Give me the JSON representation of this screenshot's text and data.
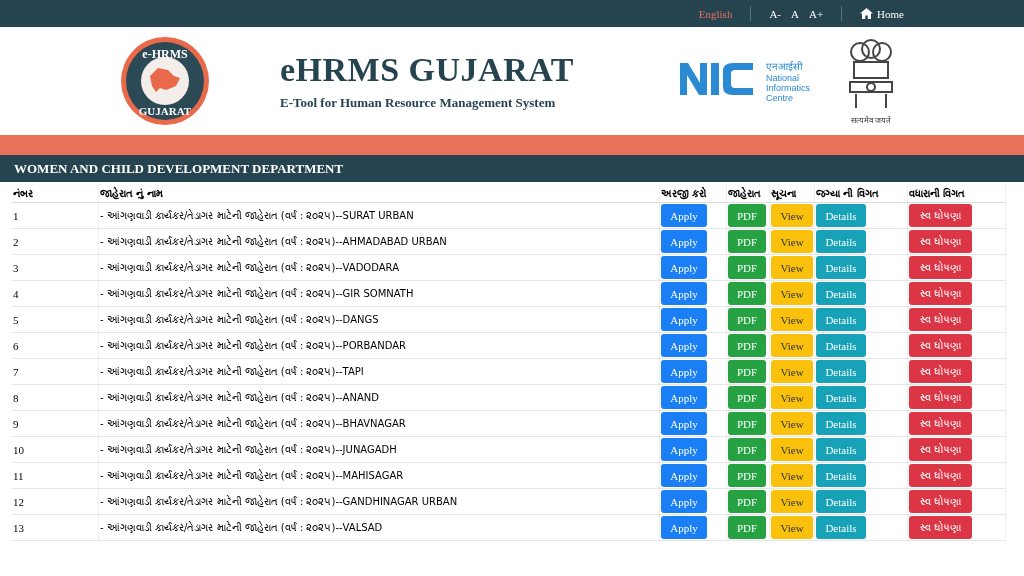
{
  "top_bar": {
    "language": "English",
    "font_sizes": [
      "A-",
      "A",
      "A+"
    ],
    "home": "Home"
  },
  "header": {
    "logo_text_top": "e-HRMS",
    "logo_text_bottom": "GUJARAT",
    "title": "eHRMS GUJARAT",
    "subtitle": "E-Tool for Human Resource Management System",
    "nic_hindi": "एनआईसी",
    "nic_name": "National Informatics Centre",
    "emblem_caption": "सत्यमेव जयते"
  },
  "department": "WOMEN AND CHILD DEVELOPMENT DEPARTMENT",
  "table": {
    "columns": [
      "નંબર",
      "જાહેરાત નું નામ",
      "અરજી કરો",
      "જાહેરાત",
      "સૂચના",
      "જગ્યા ની વિગત",
      "વધારાની વિગત"
    ],
    "rows": [
      {
        "number": "1",
        "name": "- આંગણવાડી કાર્યકર/તેડાગર માટેની જાહેરાત (વર્ષ : ૨૦૨૫)--SURAT URBAN",
        "buttons": [
          "Apply",
          "PDF",
          "View",
          "Details",
          "સ્વ ઘોષણા"
        ]
      },
      {
        "number": "2",
        "name": "- આંગણવાડી કાર્યકર/તેડાગર માટેની જાહેરાત (વર્ષ : ૨૦૨૫)--AHMADABAD URBAN",
        "buttons": [
          "Apply",
          "PDF",
          "View",
          "Details",
          "સ્વ ઘોષણા"
        ]
      },
      {
        "number": "3",
        "name": "- આંગણવાડી કાર્યકર/તેડાગર માટેની જાહેરાત (વર્ષ : ૨૦૨૫)--VADODARA",
        "buttons": [
          "Apply",
          "PDF",
          "View",
          "Details",
          "સ્વ ઘોષણા"
        ]
      },
      {
        "number": "4",
        "name": "- આંગણવાડી કાર્યકર/તેડાગર માટેની જાહેરાત (વર્ષ : ૨૦૨૫)--GIR SOMNATH",
        "buttons": [
          "Apply",
          "PDF",
          "View",
          "Details",
          "સ્વ ઘોષણા"
        ]
      },
      {
        "number": "5",
        "name": "- આંગણવાડી કાર્યકર/તેડાગર માટેની જાહેરાત (વર્ષ : ૨૦૨૫)--DANGS",
        "buttons": [
          "Apply",
          "PDF",
          "View",
          "Details",
          "સ્વ ઘોષણા"
        ]
      },
      {
        "number": "6",
        "name": "- આંગણવાડી કાર્યકર/તેડાગર માટેની જાહેરાત (વર્ષ : ૨૦૨૫)--PORBANDAR",
        "buttons": [
          "Apply",
          "PDF",
          "View",
          "Details",
          "સ્વ ઘોષણા"
        ]
      },
      {
        "number": "7",
        "name": "- આંગણવાડી કાર્યકર/તેડાગર માટેની જાહેરાત (વર્ષ : ૨૦૨૫)--TAPI",
        "buttons": [
          "Apply",
          "PDF",
          "View",
          "Details",
          "સ્વ ઘોષણા"
        ]
      },
      {
        "number": "8",
        "name": "- આંગણવાડી કાર્યકર/તેડાગર માટેની જાહેરાત (વર્ષ : ૨૦૨૫)--ANAND",
        "buttons": [
          "Apply",
          "PDF",
          "View",
          "Details",
          "સ્વ ઘોષણા"
        ]
      },
      {
        "number": "9",
        "name": "- આંગણવાડી કાર્યકર/તેડાગર માટેની જાહેરાત (વર્ષ : ૨૦૨૫)--BHAVNAGAR",
        "buttons": [
          "Apply",
          "PDF",
          "View",
          "Details",
          "સ્વ ઘોષણા"
        ]
      },
      {
        "number": "10",
        "name": "- આંગણવાડી કાર્યકર/તેડાગર માટેની જાહેરાત (વર્ષ : ૨૦૨૫)--JUNAGADH",
        "buttons": [
          "Apply",
          "PDF",
          "View",
          "Details",
          "સ્વ ઘોષણા"
        ]
      },
      {
        "number": "11",
        "name": "- આંગણવાડી કાર્યકર/તેડાગર માટેની જાહેરાત (વર્ષ : ૨૦૨૫)--MAHISAGAR",
        "buttons": [
          "Apply",
          "PDF",
          "View",
          "Details",
          "સ્વ ઘોષણા"
        ]
      },
      {
        "number": "12",
        "name": "- આંગણવાડી કાર્યકર/તેડાગર માટેની જાહેરાત (વર્ષ : ૨૦૨૫)--GANDHINAGAR URBAN",
        "buttons": [
          "Apply",
          "PDF",
          "View",
          "Details",
          "સ્વ ઘોષણા"
        ]
      },
      {
        "number": "13",
        "name": "- આંગણવાડી કાર્યકર/તેડાગર માટેની જાહેરાત (વર્ષ : ૨૦૨૫)--VALSAD",
        "buttons": [
          "Apply",
          "PDF",
          "View",
          "Details",
          "સ્વ ઘોષણા"
        ]
      }
    ]
  }
}
